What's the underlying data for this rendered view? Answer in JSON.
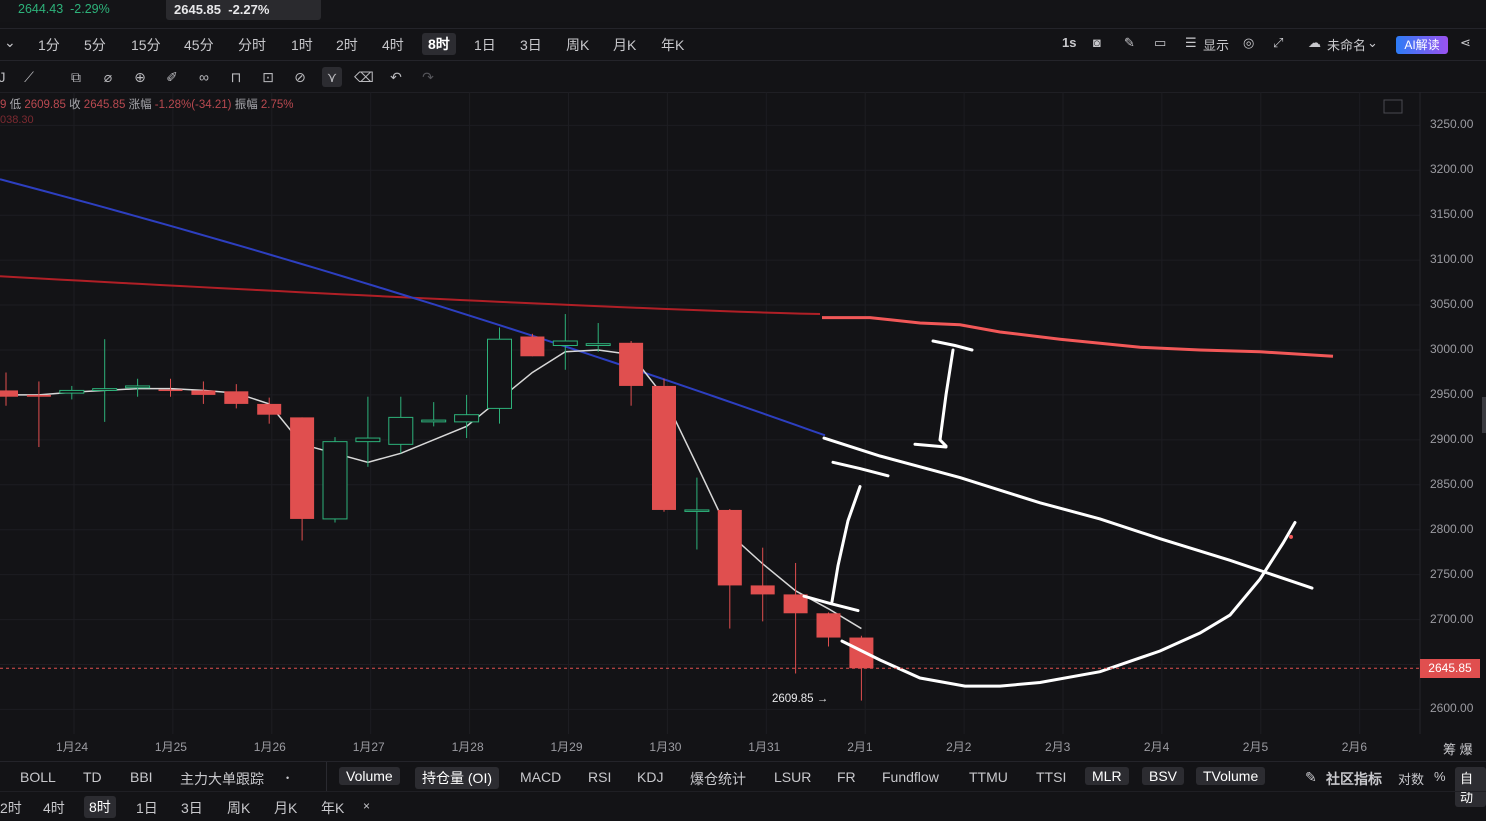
{
  "ticker": {
    "price_a": "2644.43",
    "change_a": "-2.29%",
    "price_b": "2645.85",
    "change_b": "-2.27%"
  },
  "timeframes": [
    "1分",
    "5分",
    "15分",
    "45分",
    "分时",
    "1时",
    "2时",
    "4时",
    "8时",
    "1日",
    "3日",
    "周K",
    "月K",
    "年K"
  ],
  "active_timeframe": "8时",
  "right_controls": {
    "interval": "1s",
    "display": "显示",
    "layout_name": "未命名",
    "ai_button": "AI解读"
  },
  "ohlc": {
    "low_label": "低",
    "low": "2609.85",
    "close_label": "收",
    "close": "2645.85",
    "chg_label": "涨幅",
    "chg": "-1.28%(-34.21)",
    "amp_label": "振幅",
    "amp": "2.75%",
    "line2": "038.30",
    "prefix": "9"
  },
  "colors": {
    "up": "#2db27a",
    "down": "#e04f4f",
    "ma_slow": "#b01f26",
    "ma_mid": "#2d3fc0",
    "ma_fast": "#d8d8d8",
    "drawing": "#ffffff"
  },
  "chart_data": {
    "type": "candlestick",
    "interval": "8h",
    "x_labels": [
      "1月24",
      "1月25",
      "1月26",
      "1月27",
      "1月28",
      "1月29",
      "1月30",
      "1月31",
      "2月1",
      "2月2",
      "2月3",
      "2月4",
      "2月5",
      "2月6"
    ],
    "y_ticks": [
      3250,
      3200,
      3150,
      3100,
      3050,
      3000,
      2950,
      2900,
      2850,
      2800,
      2750,
      2700,
      2600
    ],
    "ylim": [
      2580,
      3270
    ],
    "candles": [
      {
        "o": 2955,
        "h": 2975,
        "l": 2938,
        "c": 2948
      },
      {
        "o": 2950,
        "h": 2965,
        "l": 2892,
        "c": 2948
      },
      {
        "o": 2952,
        "h": 2960,
        "l": 2945,
        "c": 2955
      },
      {
        "o": 2955,
        "h": 3012,
        "l": 2920,
        "c": 2957
      },
      {
        "o": 2958,
        "h": 2968,
        "l": 2948,
        "c": 2960
      },
      {
        "o": 2956,
        "h": 2968,
        "l": 2948,
        "c": 2955
      },
      {
        "o": 2955,
        "h": 2965,
        "l": 2940,
        "c": 2950
      },
      {
        "o": 2954,
        "h": 2962,
        "l": 2935,
        "c": 2940
      },
      {
        "o": 2940,
        "h": 2947,
        "l": 2918,
        "c": 2928
      },
      {
        "o": 2925,
        "h": 2925,
        "l": 2788,
        "c": 2812
      },
      {
        "o": 2812,
        "h": 2903,
        "l": 2808,
        "c": 2898
      },
      {
        "o": 2898,
        "h": 2948,
        "l": 2870,
        "c": 2902
      },
      {
        "o": 2895,
        "h": 2948,
        "l": 2885,
        "c": 2925
      },
      {
        "o": 2920,
        "h": 2942,
        "l": 2915,
        "c": 2922
      },
      {
        "o": 2920,
        "h": 2950,
        "l": 2902,
        "c": 2928
      },
      {
        "o": 2935,
        "h": 3025,
        "l": 2918,
        "c": 3012
      },
      {
        "o": 3015,
        "h": 3018,
        "l": 2993,
        "c": 2993
      },
      {
        "o": 3005,
        "h": 3040,
        "l": 2978,
        "c": 3010
      },
      {
        "o": 3005,
        "h": 3030,
        "l": 2998,
        "c": 3007
      },
      {
        "o": 3008,
        "h": 3010,
        "l": 2938,
        "c": 2960
      },
      {
        "o": 2960,
        "h": 2968,
        "l": 2820,
        "c": 2822
      },
      {
        "o": 2822,
        "h": 2858,
        "l": 2778,
        "c": 2822
      },
      {
        "o": 2822,
        "h": 2823,
        "l": 2690,
        "c": 2738
      },
      {
        "o": 2738,
        "h": 2780,
        "l": 2698,
        "c": 2728
      },
      {
        "o": 2728,
        "h": 2763,
        "l": 2640,
        "c": 2707
      },
      {
        "o": 2707,
        "h": 2708,
        "l": 2670,
        "c": 2680
      },
      {
        "o": 2680,
        "h": 2682,
        "l": 2609.85,
        "c": 2645.85
      }
    ],
    "ma_fast": [
      2950,
      2950,
      2953,
      2955,
      2957,
      2957,
      2955,
      2952,
      2940,
      2895,
      2885,
      2875,
      2885,
      2900,
      2915,
      2945,
      2975,
      2998,
      3000,
      2995,
      2948,
      2872,
      2795,
      2762,
      2732,
      2712,
      2690
    ],
    "ma_mid_start": 3190,
    "ma_mid_end": 2905,
    "ma_slow_start": 3082,
    "ma_slow_end": 3040,
    "current_price": 2645.85,
    "low_label": "2609.85"
  },
  "x_axis_right": "筹 爆",
  "indicators": [
    "BOLL",
    "TD",
    "BBI",
    "主力大单跟踪"
  ],
  "sub_indicators": [
    {
      "label": "Volume",
      "on": true
    },
    {
      "label": "持仓量 (OI)",
      "on": true
    },
    {
      "label": "MACD",
      "on": false
    },
    {
      "label": "RSI",
      "on": false
    },
    {
      "label": "KDJ",
      "on": false
    },
    {
      "label": "爆仓统计",
      "on": false
    },
    {
      "label": "LSUR",
      "on": false
    },
    {
      "label": "FR",
      "on": false
    },
    {
      "label": "Fundflow",
      "on": false
    },
    {
      "label": "TTMU",
      "on": false
    },
    {
      "label": "TTSI",
      "on": false
    },
    {
      "label": "MLR",
      "on": true
    },
    {
      "label": "BSV",
      "on": true
    },
    {
      "label": "TVolume",
      "on": true
    }
  ],
  "right_indicators": {
    "community": "社区指标",
    "log": "对数",
    "pct": "%",
    "auto": "自动"
  },
  "bottom_timeframes": [
    "2时",
    "4时",
    "8时",
    "1日",
    "3日",
    "周K",
    "月K",
    "年K"
  ],
  "bottom_active": "8时"
}
